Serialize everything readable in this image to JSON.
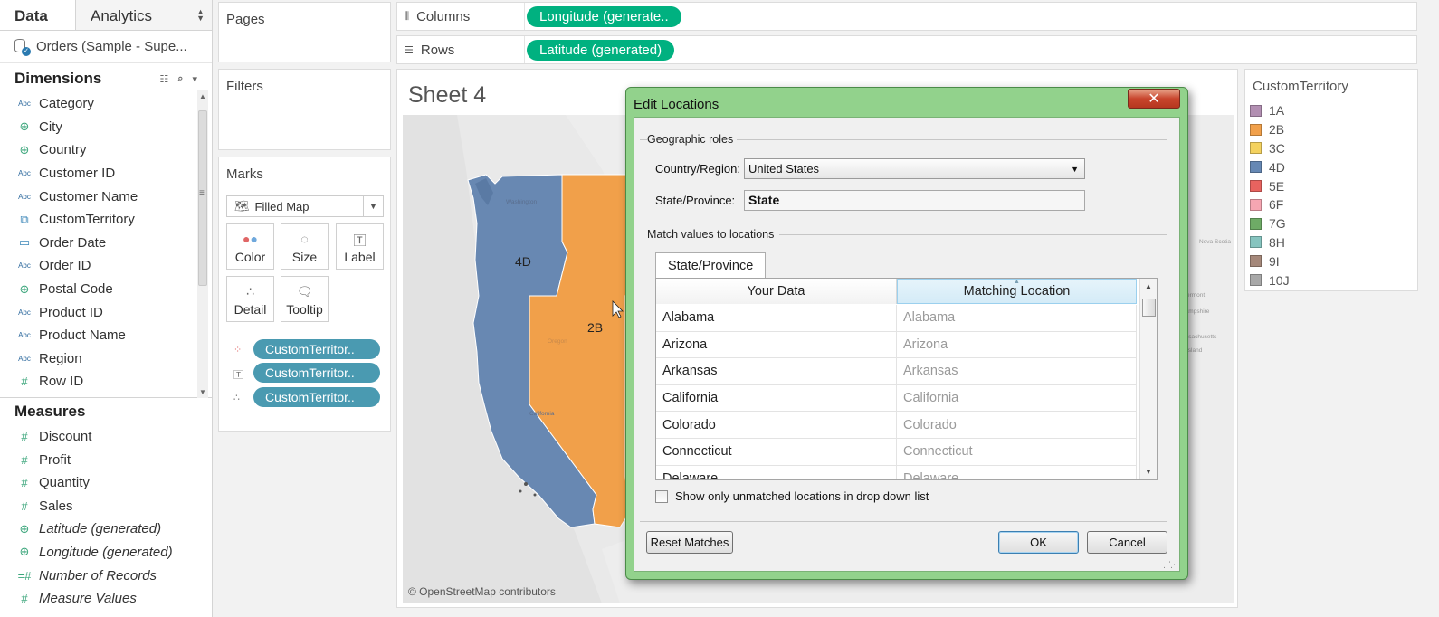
{
  "data_pane": {
    "tabs": [
      "Data",
      "Analytics"
    ],
    "datasource": "Orders (Sample - Supe...",
    "dimensions_title": "Dimensions",
    "dimensions": [
      {
        "icon": "Abc",
        "label": "Category"
      },
      {
        "icon": "globe",
        "label": "City"
      },
      {
        "icon": "globe",
        "label": "Country"
      },
      {
        "icon": "Abc",
        "label": "Customer ID"
      },
      {
        "icon": "Abc",
        "label": "Customer Name"
      },
      {
        "icon": "paperclip",
        "label": "CustomTerritory"
      },
      {
        "icon": "calendar",
        "label": "Order Date"
      },
      {
        "icon": "Abc",
        "label": "Order ID"
      },
      {
        "icon": "globe",
        "label": "Postal Code"
      },
      {
        "icon": "Abc",
        "label": "Product ID"
      },
      {
        "icon": "Abc",
        "label": "Product Name"
      },
      {
        "icon": "Abc",
        "label": "Region"
      },
      {
        "icon": "#",
        "label": "Row ID"
      }
    ],
    "measures_title": "Measures",
    "measures": [
      {
        "icon": "#",
        "label": "Discount",
        "italic": false
      },
      {
        "icon": "#",
        "label": "Profit",
        "italic": false
      },
      {
        "icon": "#",
        "label": "Quantity",
        "italic": false
      },
      {
        "icon": "#",
        "label": "Sales",
        "italic": false
      },
      {
        "icon": "globe",
        "label": "Latitude (generated)",
        "italic": true
      },
      {
        "icon": "globe",
        "label": "Longitude (generated)",
        "italic": true
      },
      {
        "icon": "=#",
        "label": "Number of Records",
        "italic": true
      },
      {
        "icon": "#",
        "label": "Measure Values",
        "italic": true
      }
    ]
  },
  "cards": {
    "pages": "Pages",
    "filters": "Filters",
    "marks": "Marks",
    "mark_type": "Filled Map",
    "mark_buttons": [
      "Color",
      "Size",
      "Label",
      "Detail",
      "Tooltip"
    ],
    "mark_pills": [
      "CustomTerritor..",
      "CustomTerritor..",
      "CustomTerritor.."
    ]
  },
  "shelves": {
    "columns_label": "Columns",
    "columns_pill": "Longitude (generate..",
    "rows_label": "Rows",
    "rows_pill": "Latitude (generated)"
  },
  "viz": {
    "sheet_title": "Sheet 4",
    "attribution": "© OpenStreetMap contributors",
    "territory_labels": [
      "4D",
      "2B"
    ],
    "faint_map_labels": [
      "Washington",
      "Oregon",
      "California",
      "Nova Scotia",
      "Vermont",
      "Hampshire",
      "Massachusetts",
      "Island"
    ]
  },
  "legend": {
    "title": "CustomTerritory",
    "items": [
      {
        "label": "1A",
        "color": "#b28fb2"
      },
      {
        "label": "2B",
        "color": "#f1a04a"
      },
      {
        "label": "3C",
        "color": "#f4d25f"
      },
      {
        "label": "4D",
        "color": "#6688b4"
      },
      {
        "label": "5E",
        "color": "#e8635f"
      },
      {
        "label": "6F",
        "color": "#f6a6b2"
      },
      {
        "label": "7G",
        "color": "#6eab66"
      },
      {
        "label": "8H",
        "color": "#86c4bf"
      },
      {
        "label": "9I",
        "color": "#a5887a"
      },
      {
        "label": "10J",
        "color": "#a8a8a8"
      }
    ]
  },
  "dialog": {
    "title": "Edit Locations",
    "geo_roles_label": "Geographic roles",
    "country_label": "Country/Region:",
    "country_value": "United States",
    "state_label": "State/Province:",
    "state_value": "State",
    "match_label": "Match values to locations",
    "tab_label": "State/Province",
    "col_your_data": "Your Data",
    "col_matching": "Matching Location",
    "rows": [
      {
        "data": "Alabama",
        "match": "Alabama"
      },
      {
        "data": "Arizona",
        "match": "Arizona"
      },
      {
        "data": "Arkansas",
        "match": "Arkansas"
      },
      {
        "data": "California",
        "match": "California"
      },
      {
        "data": "Colorado",
        "match": "Colorado"
      },
      {
        "data": "Connecticut",
        "match": "Connecticut"
      },
      {
        "data": "Delaware",
        "match": "Delaware"
      }
    ],
    "checkbox_label": "Show only unmatched locations in drop down list",
    "reset_button": "Reset Matches",
    "ok_button": "OK",
    "cancel_button": "Cancel"
  }
}
